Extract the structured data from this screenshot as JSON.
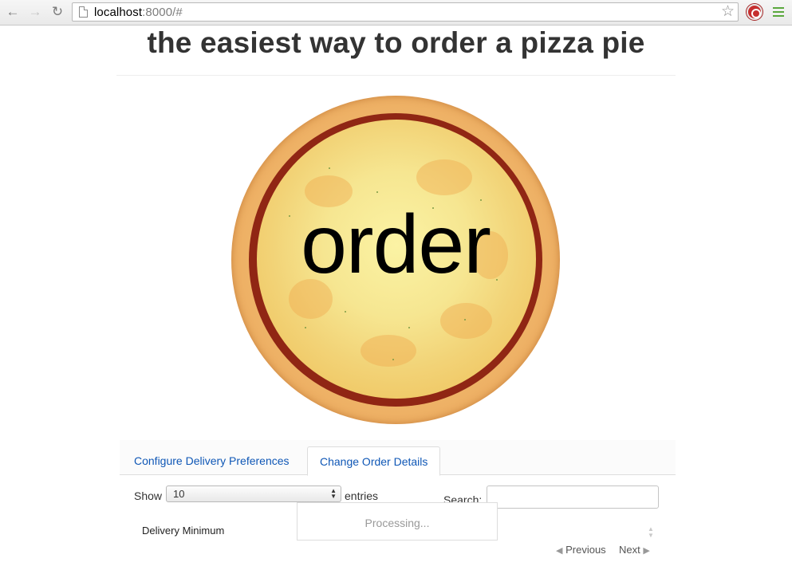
{
  "browser": {
    "back_icon": "back-arrow-icon",
    "forward_icon": "forward-arrow-icon",
    "reload_icon": "reload-icon",
    "url_host": "localhost",
    "url_rest": ":8000/#",
    "bookmark_icon": "star-icon",
    "extension_icon": "adblock-icon",
    "menu_icon": "hamburger-menu-icon"
  },
  "page": {
    "title": "the easiest way to order a pizza pie",
    "order_button_text": "order"
  },
  "tabs": [
    {
      "label": "Configure Delivery Preferences",
      "active": false
    },
    {
      "label": "Change Order Details",
      "active": true
    }
  ],
  "table_controls": {
    "show_label": "Show",
    "length_value": "10",
    "entries_label": "entries",
    "search_label": "Search:",
    "search_value": ""
  },
  "table": {
    "columns": [
      "Delivery Minimum"
    ],
    "processing_text": "Processing..."
  },
  "pagination": {
    "previous_label": "Previous",
    "next_label": "Next"
  },
  "colors": {
    "link": "#0f57b6",
    "title": "#333333",
    "processing_text": "#999999"
  }
}
